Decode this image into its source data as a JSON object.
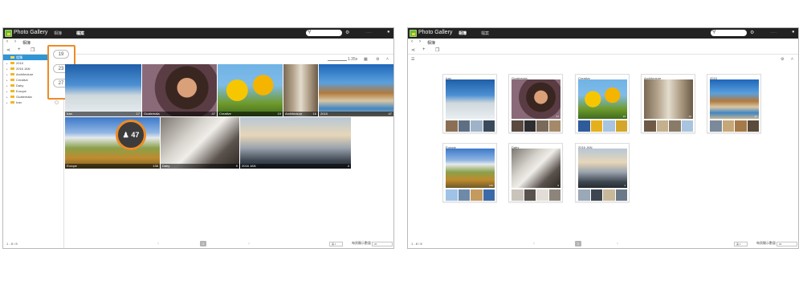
{
  "left_window": {
    "app_title": "Photo Gallery",
    "tabs": [
      "相簿",
      "檔案"
    ],
    "breadcrumb": "相簿",
    "tree": {
      "selected": "相簿",
      "items": [
        "2015",
        "2016 JAN",
        "Architecture",
        "Creative",
        "Dairy",
        "Europe",
        "Guatemala",
        "Iran"
      ]
    },
    "count_pills": [
      "19",
      "23",
      "27"
    ],
    "badge_count": "47",
    "zoom_label": "1.35x",
    "tiles": [
      {
        "title": "Iran",
        "count": "17"
      },
      {
        "title": "Guatemala",
        "count": "47"
      },
      {
        "title": "Creative",
        "count": "19"
      },
      {
        "title": "Architecture",
        "count": "16"
      },
      {
        "title": "2015",
        "count": "47"
      },
      {
        "title": "Europe",
        "count": "136"
      },
      {
        "title": "Dairy",
        "count": "9"
      },
      {
        "title": "2016 JAN",
        "count": "4"
      }
    ],
    "footer_range": "1 - 8 / 8",
    "page_number": "1",
    "view_select": "第 1",
    "per_page_label": "每頁顯示數量",
    "per_page_value": "20"
  },
  "right_window": {
    "app_title": "Photo Gallery",
    "tabs": [
      "相簿",
      "檔案"
    ],
    "breadcrumb": "相簿",
    "albums": [
      {
        "name": "Iran",
        "count": "17"
      },
      {
        "name": "Guatemala",
        "count": "47"
      },
      {
        "name": "Creative",
        "count": "19"
      },
      {
        "name": "Architecture",
        "count": "16"
      },
      {
        "name": "2015",
        "count": "47"
      },
      {
        "name": "Europe",
        "count": "136"
      },
      {
        "name": "Dairy",
        "count": "9"
      },
      {
        "name": "2016 JAN",
        "count": "4"
      }
    ],
    "footer_range": "1 - 8 / 8",
    "page_number": "1",
    "view_select": "第 1",
    "per_page_label": "每頁顯示數量",
    "per_page_value": "20"
  },
  "icons": {
    "back": "‹",
    "forward": "›",
    "share": "share-icon",
    "add": "+",
    "copy": "copy-icon",
    "search": "search-icon",
    "user": "user-icon",
    "settings": "gear-icon",
    "chevron_up": "chevron-up-icon"
  },
  "colors": {
    "accent_orange": "#f08a24",
    "selection_blue": "#2f96d6",
    "topbar": "#222222",
    "folder": "#f2b522"
  }
}
